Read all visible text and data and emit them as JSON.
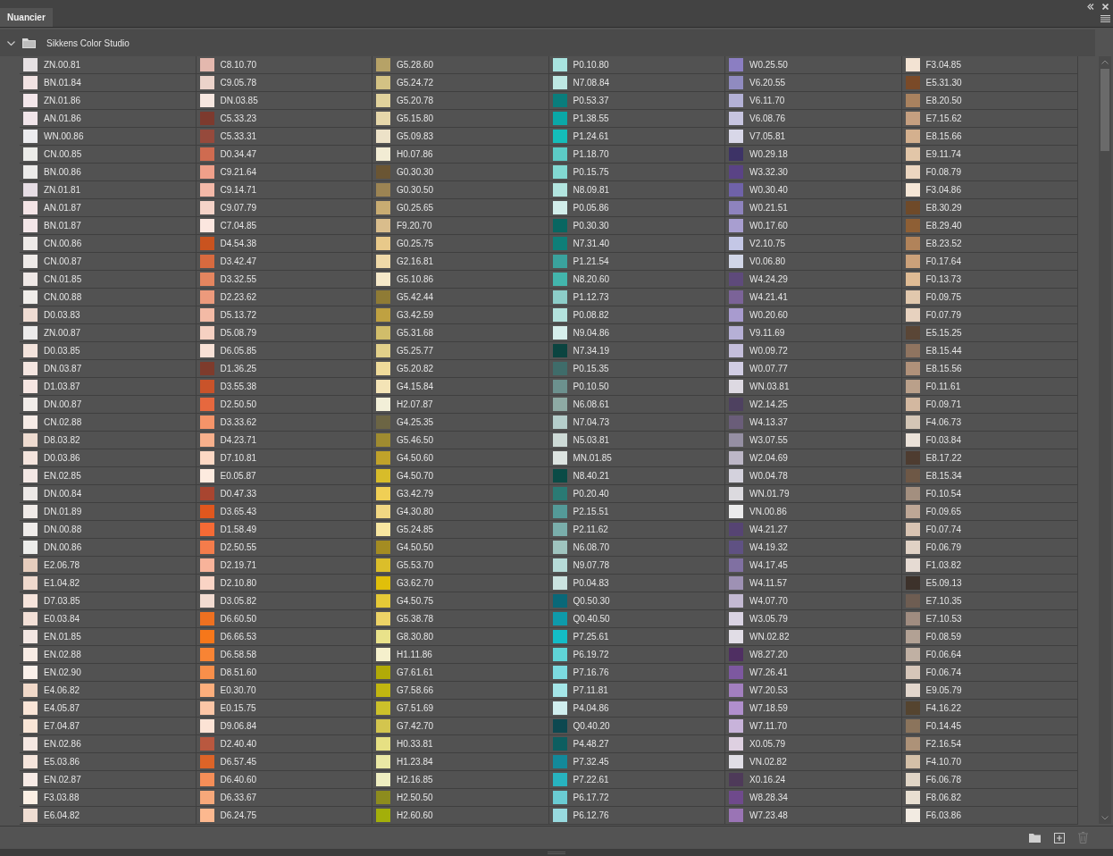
{
  "tabs": [
    {
      "label": "Nuancier",
      "selected": true
    }
  ],
  "group": {
    "name": "Sikkens Color Studio",
    "expanded": true
  },
  "columns": [
    {
      "swatches": [
        {
          "name": "ZN.00.81",
          "color": "#e6e1e3"
        },
        {
          "name": "BN.01.84",
          "color": "#f1e2e2"
        },
        {
          "name": "ZN.01.86",
          "color": "#f3e6ea"
        },
        {
          "name": "AN.01.86",
          "color": "#f1e5ea"
        },
        {
          "name": "WN.00.86",
          "color": "#ebebee"
        },
        {
          "name": "CN.00.85",
          "color": "#ebebe8"
        },
        {
          "name": "BN.00.86",
          "color": "#ecebea"
        },
        {
          "name": "ZN.01.81",
          "color": "#e6dde4"
        },
        {
          "name": "AN.01.87",
          "color": "#f4e4e6"
        },
        {
          "name": "BN.01.87",
          "color": "#f3e6e8"
        },
        {
          "name": "CN.00.86",
          "color": "#eeeae8"
        },
        {
          "name": "CN.00.87",
          "color": "#efebe9"
        },
        {
          "name": "CN.01.85",
          "color": "#efe8e6"
        },
        {
          "name": "CN.00.88",
          "color": "#f0edea"
        },
        {
          "name": "D0.03.83",
          "color": "#efdcd3"
        },
        {
          "name": "ZN.00.87",
          "color": "#ecebeb"
        },
        {
          "name": "D0.03.85",
          "color": "#f3e3dc"
        },
        {
          "name": "DN.03.87",
          "color": "#f5e6e1"
        },
        {
          "name": "D1.03.87",
          "color": "#f6e6e2"
        },
        {
          "name": "DN.00.87",
          "color": "#f1ece9"
        },
        {
          "name": "CN.02.88",
          "color": "#f6ebe6"
        },
        {
          "name": "D8.03.82",
          "color": "#eedbd0"
        },
        {
          "name": "D0.03.86",
          "color": "#f4e4dd"
        },
        {
          "name": "EN.02.85",
          "color": "#f3e7e4"
        },
        {
          "name": "DN.00.84",
          "color": "#ece8e6"
        },
        {
          "name": "DN.01.89",
          "color": "#f0ebe8"
        },
        {
          "name": "DN.00.88",
          "color": "#efecea"
        },
        {
          "name": "DN.00.86",
          "color": "#ededeb"
        },
        {
          "name": "E2.06.78",
          "color": "#e6cdbd"
        },
        {
          "name": "E1.04.82",
          "color": "#efd9cd"
        },
        {
          "name": "D7.03.85",
          "color": "#f6e4dc"
        },
        {
          "name": "E0.03.84",
          "color": "#f3e0d7"
        },
        {
          "name": "EN.01.85",
          "color": "#f2e6e2"
        },
        {
          "name": "EN.02.88",
          "color": "#f7ebe4"
        },
        {
          "name": "EN.02.90",
          "color": "#faf0ea"
        },
        {
          "name": "E4.06.82",
          "color": "#f1d9c9"
        },
        {
          "name": "E4.05.87",
          "color": "#fae5d7"
        },
        {
          "name": "E7.04.87",
          "color": "#f9e5d6"
        },
        {
          "name": "EN.02.86",
          "color": "#f5e8e2"
        },
        {
          "name": "E5.03.86",
          "color": "#f6e5dc"
        },
        {
          "name": "EN.02.87",
          "color": "#f7ebe6"
        },
        {
          "name": "F3.03.88",
          "color": "#fbefe4"
        },
        {
          "name": "E6.04.82",
          "color": "#efddd2"
        }
      ]
    },
    {
      "swatches": [
        {
          "name": "C8.10.70",
          "color": "#e4b8ae"
        },
        {
          "name": "C9.05.78",
          "color": "#ecd3ca"
        },
        {
          "name": "DN.03.85",
          "color": "#f6e6df"
        },
        {
          "name": "C5.33.23",
          "color": "#7d3a2e"
        },
        {
          "name": "C5.33.31",
          "color": "#964a3c"
        },
        {
          "name": "D0.34.47",
          "color": "#cf6b50"
        },
        {
          "name": "C9.21.64",
          "color": "#f0a08a"
        },
        {
          "name": "C9.14.71",
          "color": "#f4b9a8"
        },
        {
          "name": "C9.07.79",
          "color": "#f5d3c8"
        },
        {
          "name": "C7.04.85",
          "color": "#fbe6df"
        },
        {
          "name": "D4.54.38",
          "color": "#c9531f"
        },
        {
          "name": "D3.42.47",
          "color": "#d86a3f"
        },
        {
          "name": "D3.32.55",
          "color": "#e4855f"
        },
        {
          "name": "D2.23.62",
          "color": "#ec9a7c"
        },
        {
          "name": "D5.13.72",
          "color": "#f3baa5"
        },
        {
          "name": "D5.08.79",
          "color": "#f6d1c2"
        },
        {
          "name": "D6.05.85",
          "color": "#f8e1d6"
        },
        {
          "name": "D1.36.25",
          "color": "#7e3b2c"
        },
        {
          "name": "D3.55.38",
          "color": "#c9532a"
        },
        {
          "name": "D2.50.50",
          "color": "#e6683e"
        },
        {
          "name": "D3.33.62",
          "color": "#f59469"
        },
        {
          "name": "D4.23.71",
          "color": "#f8b08c"
        },
        {
          "name": "D7.10.81",
          "color": "#fcd8c4"
        },
        {
          "name": "E0.05.87",
          "color": "#fdebdf"
        },
        {
          "name": "D0.47.33",
          "color": "#a84530"
        },
        {
          "name": "D3.65.43",
          "color": "#e0571e"
        },
        {
          "name": "D1.58.49",
          "color": "#f56a35"
        },
        {
          "name": "D2.50.55",
          "color": "#f47c4b"
        },
        {
          "name": "D2.19.71",
          "color": "#f8b39a"
        },
        {
          "name": "D2.10.80",
          "color": "#fad4c5"
        },
        {
          "name": "D3.05.82",
          "color": "#f2dbd1"
        },
        {
          "name": "D6.60.50",
          "color": "#ee7020"
        },
        {
          "name": "D6.66.53",
          "color": "#f6771a"
        },
        {
          "name": "D6.58.58",
          "color": "#f88434"
        },
        {
          "name": "D8.51.60",
          "color": "#f98f4a"
        },
        {
          "name": "E0.30.70",
          "color": "#fcae7c"
        },
        {
          "name": "E0.15.75",
          "color": "#fcc6a6"
        },
        {
          "name": "D9.06.84",
          "color": "#fce3d5"
        },
        {
          "name": "D2.40.40",
          "color": "#b9583f"
        },
        {
          "name": "D6.57.45",
          "color": "#dd6428"
        },
        {
          "name": "D6.40.60",
          "color": "#f58e58"
        },
        {
          "name": "D6.33.67",
          "color": "#f7a87a"
        },
        {
          "name": "D6.24.75",
          "color": "#fcb88f"
        }
      ]
    },
    {
      "swatches": [
        {
          "name": "G5.28.60",
          "color": "#b6a267"
        },
        {
          "name": "G5.24.72",
          "color": "#d3c284"
        },
        {
          "name": "G5.20.78",
          "color": "#e1d29c"
        },
        {
          "name": "G5.15.80",
          "color": "#e6d7aa"
        },
        {
          "name": "G5.09.83",
          "color": "#ede2c8"
        },
        {
          "name": "H0.07.86",
          "color": "#f2ecd4"
        },
        {
          "name": "G0.30.30",
          "color": "#6a5533"
        },
        {
          "name": "G0.30.50",
          "color": "#9c8453"
        },
        {
          "name": "G0.25.65",
          "color": "#c8ac72"
        },
        {
          "name": "F9.20.70",
          "color": "#d9bd8c"
        },
        {
          "name": "G0.25.75",
          "color": "#e8c98a"
        },
        {
          "name": "G2.16.81",
          "color": "#efd9a8"
        },
        {
          "name": "G5.10.86",
          "color": "#f6e9c9"
        },
        {
          "name": "G5.42.44",
          "color": "#8f7b35"
        },
        {
          "name": "G3.42.59",
          "color": "#bfa141"
        },
        {
          "name": "G5.31.68",
          "color": "#d1bd6a"
        },
        {
          "name": "G5.25.77",
          "color": "#e2d08a"
        },
        {
          "name": "G5.20.82",
          "color": "#efdb9a"
        },
        {
          "name": "G4.15.84",
          "color": "#f4e4b6"
        },
        {
          "name": "H2.07.87",
          "color": "#f2efd8"
        },
        {
          "name": "G4.25.35",
          "color": "#6c6544"
        },
        {
          "name": "G5.46.50",
          "color": "#9f8b30"
        },
        {
          "name": "G4.50.60",
          "color": "#c0a22a"
        },
        {
          "name": "G4.50.70",
          "color": "#d7bc2a"
        },
        {
          "name": "G3.42.79",
          "color": "#f0cf55"
        },
        {
          "name": "G4.30.80",
          "color": "#f1d783"
        },
        {
          "name": "G5.24.85",
          "color": "#f8e6a0"
        },
        {
          "name": "G4.50.50",
          "color": "#a48c22"
        },
        {
          "name": "G5.53.70",
          "color": "#dbbe2a"
        },
        {
          "name": "G3.62.70",
          "color": "#e0bf0a"
        },
        {
          "name": "G4.50.75",
          "color": "#e5c937"
        },
        {
          "name": "G5.38.78",
          "color": "#edd366"
        },
        {
          "name": "G8.30.80",
          "color": "#e9e28a"
        },
        {
          "name": "H1.11.86",
          "color": "#f5f0cc"
        },
        {
          "name": "G7.61.61",
          "color": "#b1aa07"
        },
        {
          "name": "G7.58.66",
          "color": "#c1b610"
        },
        {
          "name": "G7.51.69",
          "color": "#ccc12a"
        },
        {
          "name": "G7.42.70",
          "color": "#d3c54e"
        },
        {
          "name": "H0.33.81",
          "color": "#e6e083"
        },
        {
          "name": "H1.23.84",
          "color": "#eae8a5"
        },
        {
          "name": "H2.16.85",
          "color": "#eeedc0"
        },
        {
          "name": "H2.50.50",
          "color": "#8d8c1e"
        },
        {
          "name": "H2.60.60",
          "color": "#a3af0a"
        }
      ]
    },
    {
      "swatches": [
        {
          "name": "P0.10.80",
          "color": "#a8e3df"
        },
        {
          "name": "N7.08.84",
          "color": "#bde8e3"
        },
        {
          "name": "P0.53.37",
          "color": "#0a7d7c"
        },
        {
          "name": "P1.38.55",
          "color": "#0aa8a7"
        },
        {
          "name": "P1.24.61",
          "color": "#14bdb9"
        },
        {
          "name": "P1.18.70",
          "color": "#5ccbc6"
        },
        {
          "name": "P0.15.75",
          "color": "#82d9d2"
        },
        {
          "name": "N8.09.81",
          "color": "#b2e5df"
        },
        {
          "name": "P0.05.86",
          "color": "#d2eeeb"
        },
        {
          "name": "P0.30.30",
          "color": "#086661"
        },
        {
          "name": "N7.31.40",
          "color": "#0e7e78"
        },
        {
          "name": "P1.21.54",
          "color": "#3aa29d"
        },
        {
          "name": "N8.20.60",
          "color": "#43b5ac"
        },
        {
          "name": "P1.12.73",
          "color": "#8ccdc8"
        },
        {
          "name": "P0.08.82",
          "color": "#b3e2dd"
        },
        {
          "name": "N9.04.86",
          "color": "#d6efec"
        },
        {
          "name": "N7.34.19",
          "color": "#0b4440"
        },
        {
          "name": "P0.15.35",
          "color": "#3f6c6a"
        },
        {
          "name": "P0.10.50",
          "color": "#6c918e"
        },
        {
          "name": "N6.08.61",
          "color": "#8eaaa4"
        },
        {
          "name": "N7.04.73",
          "color": "#b5cecb"
        },
        {
          "name": "N5.03.81",
          "color": "#cddad6"
        },
        {
          "name": "MN.01.85",
          "color": "#dde4e1"
        },
        {
          "name": "N8.40.21",
          "color": "#0a4b46"
        },
        {
          "name": "P0.20.40",
          "color": "#2a7a74"
        },
        {
          "name": "P2.15.51",
          "color": "#549a98"
        },
        {
          "name": "P2.11.62",
          "color": "#7aaeab"
        },
        {
          "name": "N6.08.70",
          "color": "#9fc4bf"
        },
        {
          "name": "N9.07.78",
          "color": "#b6dbd8"
        },
        {
          "name": "P0.04.83",
          "color": "#cbe3e0"
        },
        {
          "name": "Q0.50.30",
          "color": "#0a6878"
        },
        {
          "name": "Q0.40.50",
          "color": "#0e9aaa"
        },
        {
          "name": "P7.25.61",
          "color": "#13bcc6"
        },
        {
          "name": "P6.19.72",
          "color": "#5fd4d6"
        },
        {
          "name": "P7.16.76",
          "color": "#7cdbe0"
        },
        {
          "name": "P7.11.81",
          "color": "#a4e6e8"
        },
        {
          "name": "P4.04.86",
          "color": "#d0eeee"
        },
        {
          "name": "Q0.40.20",
          "color": "#0d4850"
        },
        {
          "name": "P4.48.27",
          "color": "#0d5e60"
        },
        {
          "name": "P7.32.45",
          "color": "#13899a"
        },
        {
          "name": "P7.22.61",
          "color": "#28b3bf"
        },
        {
          "name": "P6.17.72",
          "color": "#6accd3"
        },
        {
          "name": "P6.12.76",
          "color": "#98dadf"
        }
      ]
    },
    {
      "swatches": [
        {
          "name": "W0.25.50",
          "color": "#8b7ec2"
        },
        {
          "name": "V6.20.55",
          "color": "#908bc0"
        },
        {
          "name": "V6.11.70",
          "color": "#b3b1d6"
        },
        {
          "name": "V6.08.76",
          "color": "#c7c5e0"
        },
        {
          "name": "V7.05.81",
          "color": "#d8d7e8"
        },
        {
          "name": "W0.29.18",
          "color": "#3d3366"
        },
        {
          "name": "W3.32.30",
          "color": "#5a4385"
        },
        {
          "name": "W0.30.40",
          "color": "#6f62a9"
        },
        {
          "name": "W0.21.51",
          "color": "#8e83be"
        },
        {
          "name": "W0.17.60",
          "color": "#a89ed0"
        },
        {
          "name": "V2.10.75",
          "color": "#c4c7e6"
        },
        {
          "name": "V0.06.80",
          "color": "#d1d6e7"
        },
        {
          "name": "W4.24.29",
          "color": "#5e4a7b"
        },
        {
          "name": "W4.21.41",
          "color": "#7b6398"
        },
        {
          "name": "W0.20.60",
          "color": "#a89bcf"
        },
        {
          "name": "V9.11.69",
          "color": "#b6b0d6"
        },
        {
          "name": "W0.09.72",
          "color": "#c4bedb"
        },
        {
          "name": "W0.07.77",
          "color": "#d1cde4"
        },
        {
          "name": "WN.03.81",
          "color": "#ddd9e2"
        },
        {
          "name": "W2.14.25",
          "color": "#4e4160"
        },
        {
          "name": "W4.13.37",
          "color": "#6a5d79"
        },
        {
          "name": "W3.07.55",
          "color": "#958fa3"
        },
        {
          "name": "W2.04.69",
          "color": "#bdb7c7"
        },
        {
          "name": "W0.04.78",
          "color": "#d4d2dd"
        },
        {
          "name": "WN.01.79",
          "color": "#dcdadf"
        },
        {
          "name": "VN.00.86",
          "color": "#ebebec"
        },
        {
          "name": "W4.21.27",
          "color": "#564473"
        },
        {
          "name": "W4.19.32",
          "color": "#5f5183"
        },
        {
          "name": "W4.17.45",
          "color": "#8070a2"
        },
        {
          "name": "W4.11.57",
          "color": "#9e91b4"
        },
        {
          "name": "W4.07.70",
          "color": "#c3b9d2"
        },
        {
          "name": "W3.05.79",
          "color": "#d9d3e3"
        },
        {
          "name": "WN.02.82",
          "color": "#e1dde6"
        },
        {
          "name": "W8.27.20",
          "color": "#4f2f62"
        },
        {
          "name": "W7.26.41",
          "color": "#7d58a0"
        },
        {
          "name": "W7.20.53",
          "color": "#a27fbf"
        },
        {
          "name": "W7.18.59",
          "color": "#b08fcd"
        },
        {
          "name": "W7.11.70",
          "color": "#c8b3da"
        },
        {
          "name": "X0.05.79",
          "color": "#ded0e1"
        },
        {
          "name": "VN.02.82",
          "color": "#e0dee6"
        },
        {
          "name": "X0.16.24",
          "color": "#4e3a59"
        },
        {
          "name": "W8.28.34",
          "color": "#6f4a8c"
        },
        {
          "name": "W7.23.48",
          "color": "#9a74b5"
        }
      ]
    },
    {
      "swatches": [
        {
          "name": "F3.04.85",
          "color": "#f3e3d3"
        },
        {
          "name": "E5.31.30",
          "color": "#7a4a28"
        },
        {
          "name": "E8.20.50",
          "color": "#a9825f"
        },
        {
          "name": "E7.15.62",
          "color": "#c59f80"
        },
        {
          "name": "E8.15.66",
          "color": "#d4b08e"
        },
        {
          "name": "E9.11.74",
          "color": "#e2c6a8"
        },
        {
          "name": "F0.08.79",
          "color": "#ecd6c0"
        },
        {
          "name": "F3.04.86",
          "color": "#f5e6d6"
        },
        {
          "name": "E8.30.29",
          "color": "#6f4a29"
        },
        {
          "name": "E8.29.40",
          "color": "#8e5f35"
        },
        {
          "name": "E8.23.52",
          "color": "#b1835a"
        },
        {
          "name": "F0.17.64",
          "color": "#cba17a"
        },
        {
          "name": "F0.13.73",
          "color": "#dfbb94"
        },
        {
          "name": "F0.09.75",
          "color": "#e1c8ad"
        },
        {
          "name": "F0.07.79",
          "color": "#e7d2bf"
        },
        {
          "name": "E5.15.25",
          "color": "#5a4636"
        },
        {
          "name": "E8.15.44",
          "color": "#8f7460"
        },
        {
          "name": "E8.15.56",
          "color": "#b0917a"
        },
        {
          "name": "F0.11.61",
          "color": "#baa08a"
        },
        {
          "name": "F0.09.71",
          "color": "#d3b8a0"
        },
        {
          "name": "F4.06.73",
          "color": "#d4c6b6"
        },
        {
          "name": "F0.03.84",
          "color": "#ebe2d9"
        },
        {
          "name": "E8.17.22",
          "color": "#4e3c30"
        },
        {
          "name": "E8.15.34",
          "color": "#6e5846"
        },
        {
          "name": "F0.10.54",
          "color": "#a38f7f"
        },
        {
          "name": "F0.09.65",
          "color": "#bea796"
        },
        {
          "name": "F0.07.74",
          "color": "#d8c3b2"
        },
        {
          "name": "F0.06.79",
          "color": "#e1d2c5"
        },
        {
          "name": "F1.03.82",
          "color": "#e6dbd3"
        },
        {
          "name": "E5.09.13",
          "color": "#3d322b"
        },
        {
          "name": "E7.10.35",
          "color": "#6e5d52"
        },
        {
          "name": "E7.10.53",
          "color": "#a08c80"
        },
        {
          "name": "F0.08.59",
          "color": "#b2a194"
        },
        {
          "name": "F0.06.64",
          "color": "#c0b0a3"
        },
        {
          "name": "F0.06.74",
          "color": "#d6c6b9"
        },
        {
          "name": "E9.05.79",
          "color": "#e2d6cc"
        },
        {
          "name": "F4.16.22",
          "color": "#55442f"
        },
        {
          "name": "F0.14.45",
          "color": "#8b745c"
        },
        {
          "name": "F2.16.54",
          "color": "#ad9278"
        },
        {
          "name": "F4.10.70",
          "color": "#d4c0a8"
        },
        {
          "name": "F6.06.78",
          "color": "#e0d5c6"
        },
        {
          "name": "F8.06.82",
          "color": "#e8dfd1"
        },
        {
          "name": "F6.03.86",
          "color": "#f2ebe2"
        }
      ]
    }
  ]
}
